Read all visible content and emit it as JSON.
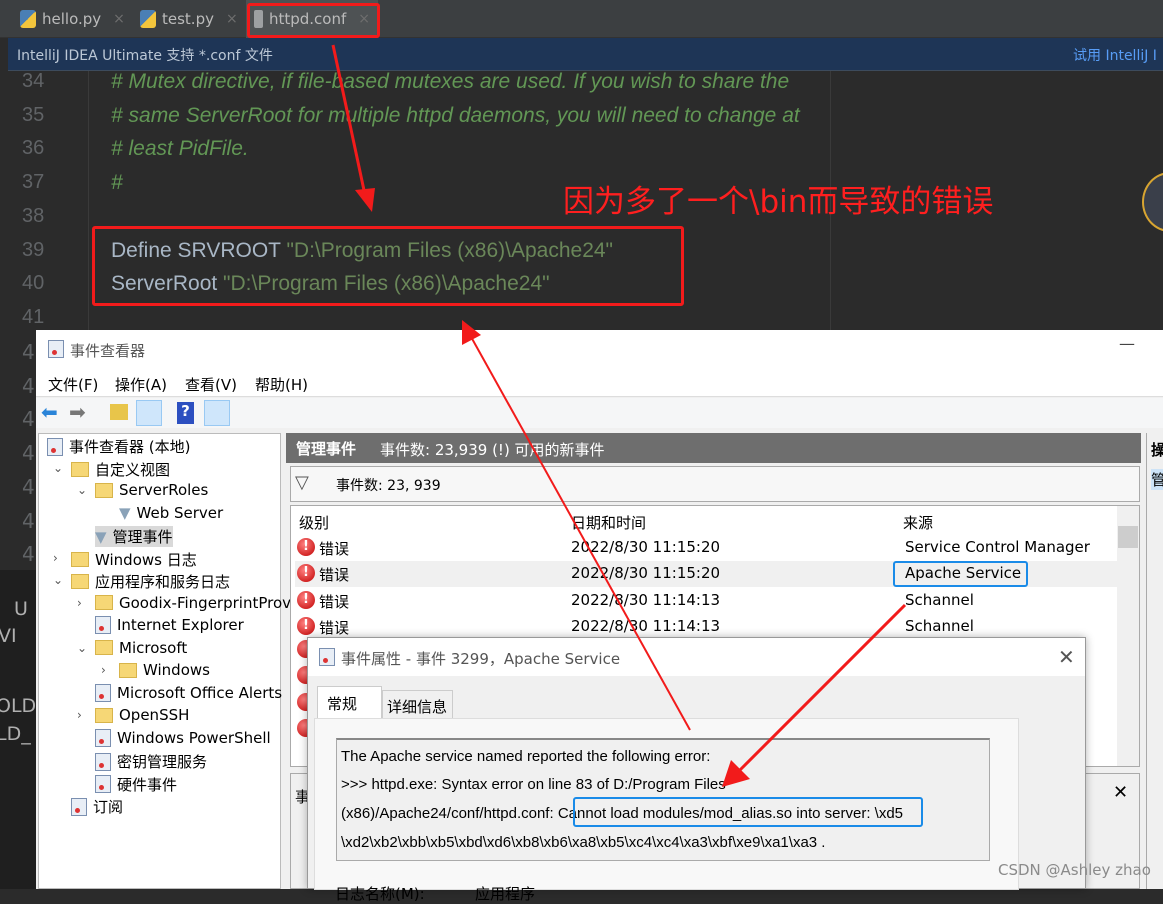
{
  "ide": {
    "tabs": [
      {
        "label": "hello.py",
        "icon": "python-file-icon"
      },
      {
        "label": "test.py",
        "icon": "python-file-icon"
      },
      {
        "label": "httpd.conf",
        "icon": "text-file-icon",
        "active": true
      }
    ],
    "close_glyph": "×",
    "notification": "IntelliJ IDEA Ultimate 支持 *.conf 文件",
    "notification_action": "试用 IntelliJ I",
    "lines": [
      {
        "n": "34",
        "comment": "# Mutex directive, if file-based mutexes are used.  If you wish to share the"
      },
      {
        "n": "35",
        "comment": "# same ServerRoot for multiple httpd daemons, you will need to change at"
      },
      {
        "n": "36",
        "comment": "# least PidFile."
      },
      {
        "n": "37",
        "comment": "#"
      },
      {
        "n": "38",
        "comment": ""
      },
      {
        "n": "39",
        "key": "Define SRVROOT ",
        "str": "\"D:\\Program Files (x86)\\Apache24\""
      },
      {
        "n": "40",
        "key": "ServerRoot ",
        "str": "\"D:\\Program Files (x86)\\Apache24\""
      },
      {
        "n": "41",
        "comment": ""
      }
    ],
    "partial_left": [
      "4",
      "4",
      "4",
      "4",
      "4",
      "4",
      "4",
      "4",
      "4",
      "4"
    ],
    "partial_left_text": [
      "U",
      "VI",
      "OLD",
      "LD_"
    ]
  },
  "annotation": "因为多了一个\\bin而导致的错误",
  "event_viewer": {
    "title": "事件查看器",
    "menu": [
      "文件(F)",
      "操作(A)",
      "查看(V)",
      "帮助(H)"
    ],
    "tree": [
      {
        "label": "事件查看器 (本地)",
        "icon": "event-viewer-icon"
      },
      {
        "label": "自定义视图",
        "icon": "folder-filter-icon",
        "expanded": true
      },
      {
        "label": "ServerRoles",
        "icon": "folder-icon",
        "expanded": true
      },
      {
        "label": "Web Server",
        "icon": "filter-icon"
      },
      {
        "label": "管理事件",
        "icon": "filter-icon",
        "selected": true
      },
      {
        "label": "Windows 日志",
        "icon": "folder-icon",
        "expanded": false
      },
      {
        "label": "应用程序和服务日志",
        "icon": "folder-icon",
        "expanded": true
      },
      {
        "label": "Goodix-FingerprintProvi",
        "icon": "folder-icon",
        "expanded": false
      },
      {
        "label": "Internet Explorer",
        "icon": "log-icon"
      },
      {
        "label": "Microsoft",
        "icon": "folder-icon",
        "expanded": true
      },
      {
        "label": "Windows",
        "icon": "folder-icon",
        "expanded": false
      },
      {
        "label": "Microsoft Office Alerts",
        "icon": "log-icon"
      },
      {
        "label": "OpenSSH",
        "icon": "folder-icon",
        "expanded": false
      },
      {
        "label": "Windows PowerShell",
        "icon": "log-icon"
      },
      {
        "label": "密钥管理服务",
        "icon": "log-icon"
      },
      {
        "label": "硬件事件",
        "icon": "log-icon"
      },
      {
        "label": "订阅",
        "icon": "subscription-icon"
      }
    ],
    "pane_title": "管理事件",
    "pane_subtitle": "事件数: 23,939 (!) 可用的新事件",
    "filter_count": "事件数:  23, 939",
    "columns": [
      "级别",
      "日期和时间",
      "来源"
    ],
    "rows": [
      {
        "level": "错误",
        "datetime": "2022/8/30 11:15:20",
        "source": "Service Control Manager"
      },
      {
        "level": "错误",
        "datetime": "2022/8/30 11:15:20",
        "source": "Apache Service",
        "selected": true
      },
      {
        "level": "错误",
        "datetime": "2022/8/30 11:14:13",
        "source": "Schannel"
      },
      {
        "level": "错误",
        "datetime": "2022/8/30 11:14:13",
        "source": "Schannel"
      }
    ],
    "lower_pane_title": "事",
    "right_pane_title": "操",
    "right_pane_item": "管"
  },
  "dialog": {
    "title": "事件属性 - 事件 3299，Apache Service",
    "tabs": [
      "常规",
      "详细信息"
    ],
    "message_lines": [
      "The Apache service named  reported the following error:",
      ">>> httpd.exe: Syntax error on line 83 of D:/Program Files",
      "(x86)/Apache24/conf/httpd.conf: ",
      "Cannot load modules/mod_alias.so into server:",
      " \\xd5",
      "\\xd2\\xb2\\xbb\\xb5\\xbd\\xd6\\xb8\\xb6\\xa8\\xb5\\xc4\\xc4\\xa3\\xbf\\xe9\\xa1\\xa3     ."
    ],
    "log_name_label": "日志名称(M):",
    "log_name_value": "应用程序"
  },
  "watermark": "CSDN @Ashley zhao",
  "colors": {
    "annotation_red": "#f21b1b",
    "highlight_blue": "#1a8be8",
    "comment": "#629755",
    "string": "#6a8759"
  }
}
